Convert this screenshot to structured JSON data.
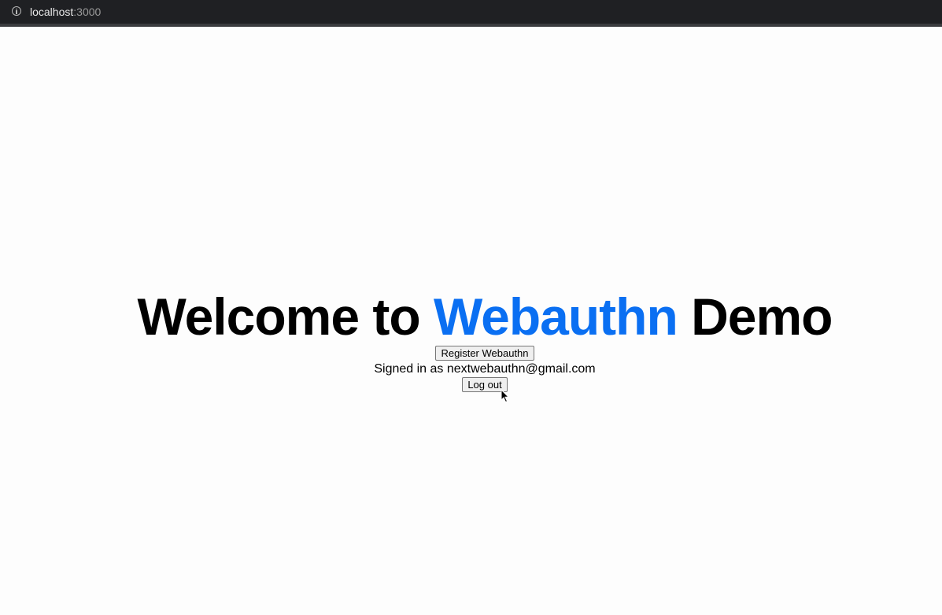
{
  "browser": {
    "url_host": "localhost",
    "url_port": ":3000"
  },
  "page": {
    "title_prefix": "Welcome to ",
    "title_accent": "Webauthn",
    "title_suffix": " Demo",
    "register_button": "Register Webauthn",
    "signed_in_text": "Signed in as nextwebauthn@gmail.com",
    "logout_button": "Log out"
  },
  "colors": {
    "accent": "#0a6ff2",
    "urlbar_bg": "#1f2023",
    "page_bg": "#fdfdfd"
  },
  "icons": {
    "site_info": "info-icon",
    "pointer": "mouse-cursor-icon"
  }
}
